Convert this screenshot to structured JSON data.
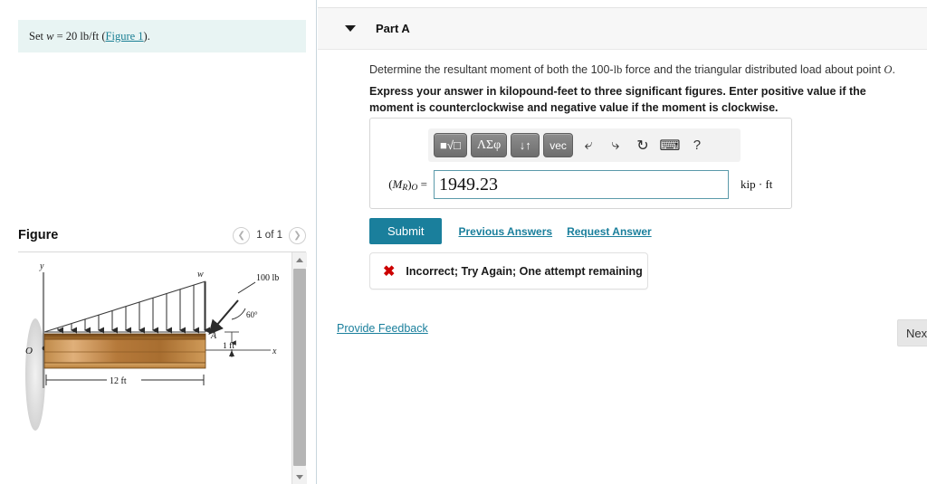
{
  "left": {
    "intro": {
      "prefix": "Set ",
      "variable": "w",
      "equals": " = 20 ",
      "units": "lb/ft",
      "paren_open": " (",
      "link": "Figure 1",
      "paren_close": ")."
    },
    "figure": {
      "title": "Figure",
      "prev_icon": "chevron-left-icon",
      "counter": "1 of 1",
      "next_icon": "chevron-right-icon"
    },
    "diagram": {
      "axis_y": "y",
      "axis_x": "x",
      "origin": "O",
      "point_a": "A",
      "load_w": "w",
      "force": "100 lb",
      "angle": "60°",
      "height_dim": "1 ft",
      "length_dim": "12 ft",
      "beam_color_top": "#8a5a24",
      "beam_color_mid": "#d2a060",
      "beam_color_bottom": "#b07a3a",
      "axis_color": "#8c8c8c"
    },
    "scrollbar": {
      "up_icon": "scroll-up-arrow-icon",
      "down_icon": "scroll-down-arrow-icon"
    }
  },
  "right": {
    "part": {
      "caret_icon": "caret-down-icon",
      "label": "Part A"
    },
    "question": {
      "line1_a": "Determine the resultant moment of both the 100-",
      "line1_lb": "lb",
      "line1_b": " force and the triangular distributed load about point ",
      "line1_point": "O",
      "line1_end": ".",
      "instructions": "Express your answer in kilopound-feet to three significant figures. Enter positive value if the moment is counterclockwise and negative value if the moment is clockwise."
    },
    "mathbar": {
      "template_label": "■√□",
      "greek_label": "ΛΣφ",
      "arrows_label": "↓↑",
      "vec_label": "vec",
      "undo_icon": "undo-arrow-icon",
      "redo_icon": "redo-arrow-icon",
      "reset_icon": "reset-circular-arrow-icon",
      "keyboard_icon": "keyboard-icon",
      "help_label": "?"
    },
    "answer": {
      "label_m": "M",
      "label_sub_r": "R",
      "label_sub_o": "O",
      "value": "1949.23",
      "placeholder": "",
      "units": "kip · ft"
    },
    "actions": {
      "submit": "Submit",
      "previous_answers": "Previous Answers",
      "request_answer": "Request Answer"
    },
    "feedback": {
      "icon": "x-mark-icon",
      "message": "Incorrect; Try Again; One attempt remaining"
    },
    "footer": {
      "provide_feedback": "Provide Feedback",
      "next": "Next"
    }
  },
  "colors": {
    "accent": "#1a7f9c",
    "error": "#cc0000",
    "intro_bg": "#e8f4f3",
    "header_bg": "#f7f7f7"
  }
}
